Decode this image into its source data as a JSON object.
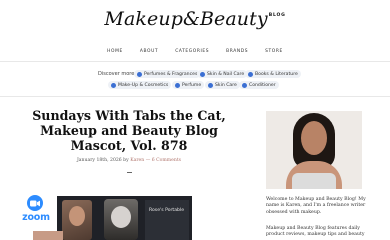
{
  "header": {
    "logo_main": "Makeup&Beauty",
    "logo_suffix": "BLOG"
  },
  "nav": {
    "items": [
      "HOME",
      "ABOUT",
      "CATEGORIES",
      "BRANDS",
      "STORE"
    ]
  },
  "discover": {
    "label": "Discover more",
    "links": [
      "Perfumes & Fragrances",
      "Skin & Nail Care",
      "Books & Literature",
      "Make-Up & Cosmetics",
      "Perfume",
      "Skin Care",
      "Conditioner"
    ]
  },
  "article": {
    "title": "Sundays With Tabs the Cat, Makeup and Beauty Blog Mascot, Vol. 878",
    "date": "January 18th, 2026 by",
    "author": "Karen",
    "separator": "—",
    "comments": "6 Comments"
  },
  "video": {
    "participant_name": "Rose's Portable",
    "app_name": "zoom"
  },
  "sidebar": {
    "intro": "Welcome to Makeup and Beauty Blog! My name is Karen, and I'm a freelance writer obsessed with makeup.",
    "features": "Makeup and Beauty Blog features daily product reviews, makeup tips and beauty"
  },
  "colors": {
    "accent_link": "#b0756d",
    "pill_background": "#eef1f6",
    "pill_icon": "#3b6fd3",
    "zoom_blue": "#2d8cff"
  }
}
